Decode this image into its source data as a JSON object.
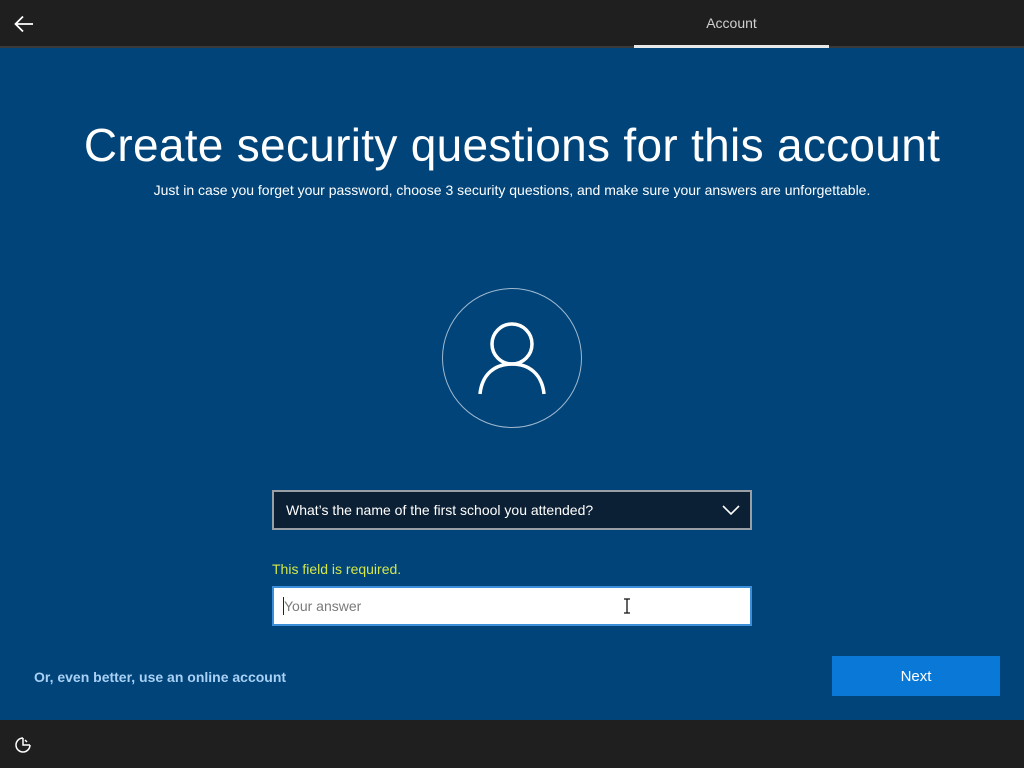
{
  "header": {
    "back_icon": "back-arrow-icon",
    "tab_label": "Account"
  },
  "main": {
    "title": "Create security questions for this account",
    "subtitle": "Just in case you forget your password, choose 3 security questions, and make sure your answers are unforgettable.",
    "avatar_icon": "user-icon",
    "question_select": {
      "selected": "What’s the name of the first school you attended?",
      "icon": "chevron-down-icon"
    },
    "error_text": "This field is required.",
    "answer_input": {
      "value": "",
      "placeholder": "Your answer"
    }
  },
  "footer": {
    "online_account_link": "Or, even better, use an online account",
    "next_label": "Next",
    "ease_of_access_icon": "ease-of-access-icon"
  },
  "colors": {
    "background": "#004479",
    "bar": "#1f1f1f",
    "accent": "#0a78d6",
    "error": "#d4e64a",
    "link": "#a9d1f5"
  }
}
